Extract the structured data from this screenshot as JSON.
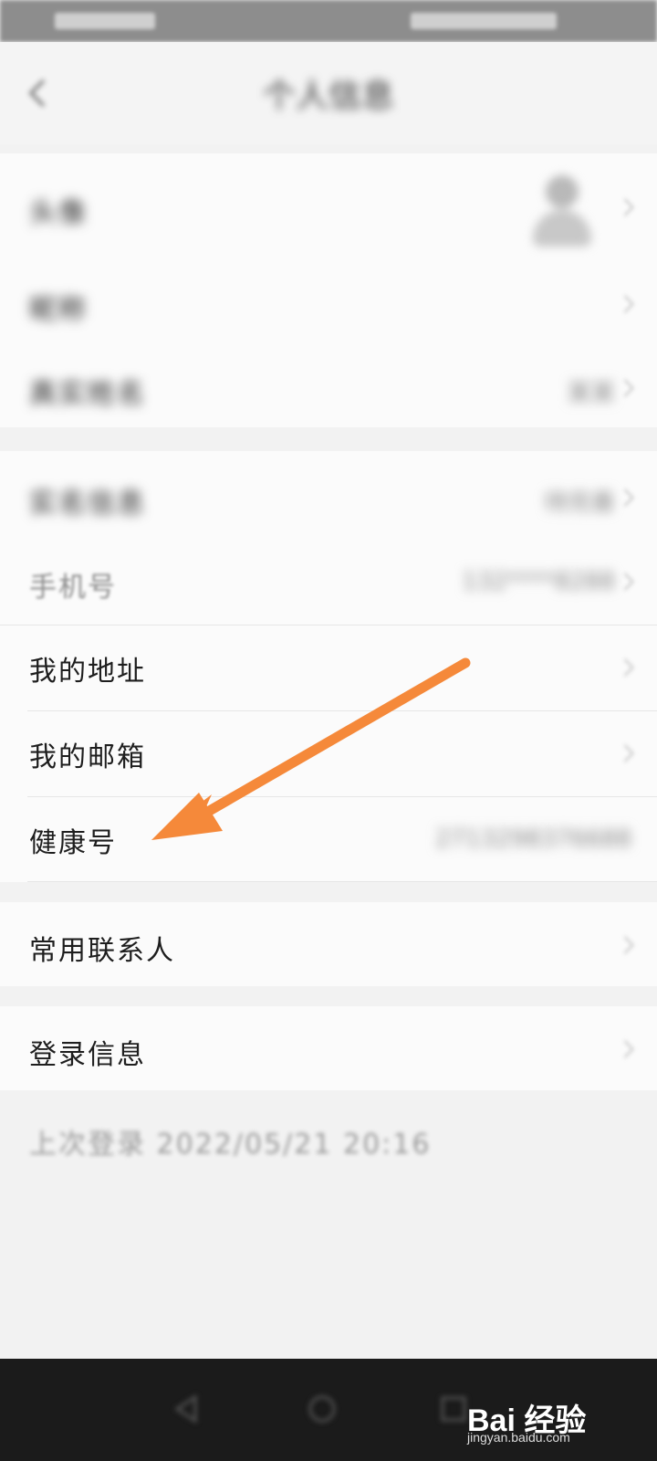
{
  "header": {
    "title": "个人信息"
  },
  "profile_group": [
    {
      "label": "头像",
      "value": ""
    },
    {
      "label": "昵称",
      "value": ""
    },
    {
      "label": "真实姓名",
      "value": "某某"
    }
  ],
  "account_group": [
    {
      "label": "实名信息",
      "value": "待完善"
    },
    {
      "label": "手机号",
      "value": "132****8288"
    },
    {
      "label": "我的地址",
      "value": ""
    },
    {
      "label": "我的邮箱",
      "value": ""
    },
    {
      "label": "健康号",
      "value": "2713298376688"
    }
  ],
  "contacts_group": {
    "label": "常用联系人"
  },
  "login_group": {
    "label": "登录信息",
    "last_login": "上次登录 2022/05/21 20:16"
  },
  "watermark": {
    "brand": "Bai 经验",
    "site": "jingyan.baidu.com"
  },
  "colors": {
    "arrow": "#f5893a",
    "card_background": "#fbfbfb",
    "page_background": "#f2f2f2",
    "nav_bar": "#1b1b1b"
  }
}
